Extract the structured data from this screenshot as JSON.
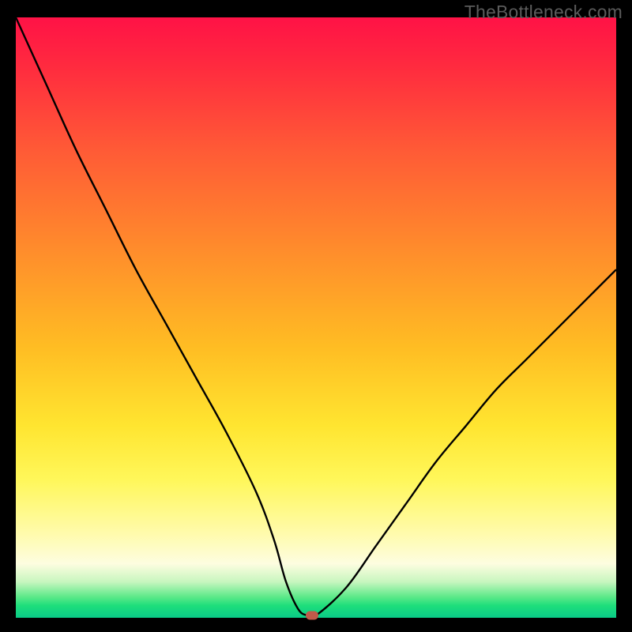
{
  "watermark": "TheBottleneck.com",
  "colors": {
    "curve": "#000000",
    "marker": "#c05a4a",
    "frame": "#000000",
    "gradient_top": "#ff1246",
    "gradient_bottom": "#0acb87"
  },
  "chart_data": {
    "type": "line",
    "title": "",
    "xlabel": "",
    "ylabel": "",
    "xlim": [
      0,
      100
    ],
    "ylim": [
      0,
      100
    ],
    "series": [
      {
        "name": "bottleneck_curve",
        "x": [
          0,
          5,
          10,
          15,
          20,
          25,
          30,
          35,
          40,
          43,
          45,
          47,
          48.5,
          50,
          55,
          60,
          65,
          70,
          75,
          80,
          85,
          90,
          95,
          100
        ],
        "values": [
          100,
          89,
          78,
          68,
          58,
          49,
          40,
          31,
          21,
          13,
          6,
          1.5,
          0.4,
          0.4,
          5,
          12,
          19,
          26,
          32,
          38,
          43,
          48,
          53,
          58
        ]
      }
    ],
    "marker": {
      "x": 49.3,
      "y": 0.35
    },
    "annotations": []
  }
}
